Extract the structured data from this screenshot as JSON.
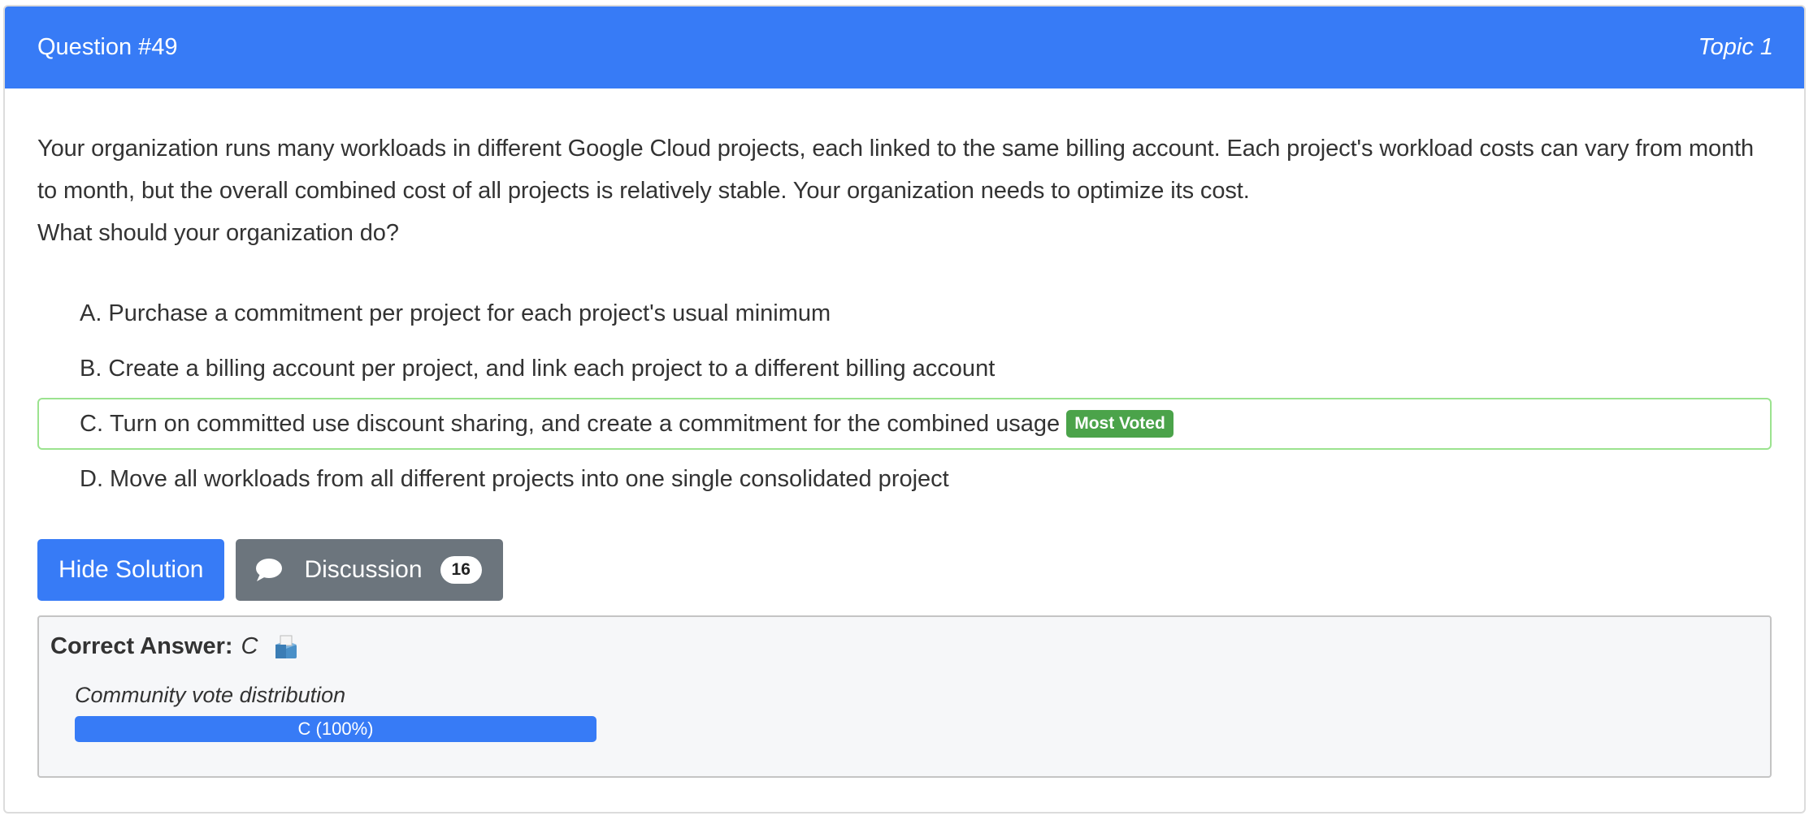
{
  "header": {
    "question_number": "Question #49",
    "topic": "Topic 1"
  },
  "question": {
    "text": "Your organization runs many workloads in different Google Cloud projects, each linked to the same billing account. Each project's workload costs can vary from month to month, but the overall combined cost of all projects is relatively stable. Your organization needs to optimize its cost.",
    "prompt": "What should your organization do?"
  },
  "choices": [
    {
      "letter": "A.",
      "text": "Purchase a commitment per project for each project's usual minimum"
    },
    {
      "letter": "B.",
      "text": "Create a billing account per project, and link each project to a different billing account"
    },
    {
      "letter": "C.",
      "text": "Turn on committed use discount sharing, and create a commitment for the combined usage",
      "badge": "Most Voted"
    },
    {
      "letter": "D.",
      "text": "Move all workloads from all different projects into one single consolidated project"
    }
  ],
  "buttons": {
    "hide_solution": "Hide Solution",
    "discussion": "Discussion",
    "discussion_count": "16"
  },
  "answer": {
    "label": "Correct Answer:",
    "value": "C",
    "vote_title": "Community vote distribution",
    "vote_bar_label": "C (100%)",
    "vote_fraction": 1.0
  },
  "colors": {
    "primary": "#377bf6",
    "secondary": "#6c757d",
    "success": "#4ba34a",
    "correct_border": "#9be38f"
  }
}
